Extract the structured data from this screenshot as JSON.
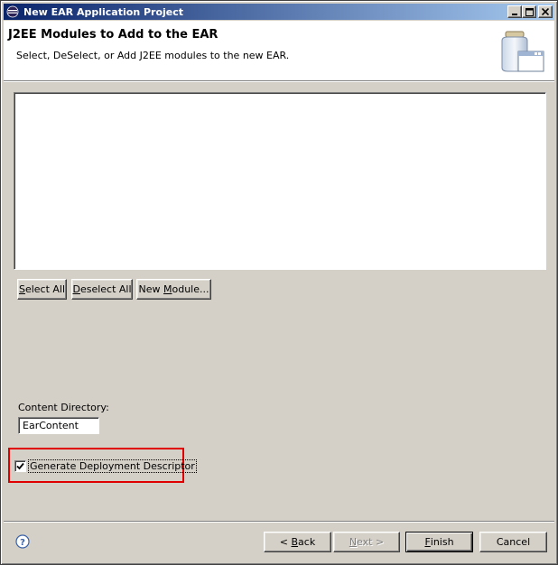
{
  "window": {
    "title": "New EAR Application Project"
  },
  "banner": {
    "title": "J2EE Modules to Add to the EAR",
    "description": "Select, DeSelect, or Add J2EE modules to the new EAR."
  },
  "module_list": {
    "items": []
  },
  "module_buttons": {
    "select_all_mnemonic": "S",
    "select_all_rest": "elect All",
    "deselect_all_mnemonic": "D",
    "deselect_all_rest": "eselect All",
    "new_module_prefix": "New ",
    "new_module_mnemonic": "M",
    "new_module_rest": "odule..."
  },
  "content_directory": {
    "label": "Content Directory:",
    "value": "EarContent"
  },
  "deployment_descriptor": {
    "label": "Generate Deployment Descriptor",
    "checked": true
  },
  "footer": {
    "back_prefix": "< ",
    "back_mnemonic": "B",
    "back_rest": "ack",
    "next_mnemonic": "N",
    "next_rest": "ext >",
    "finish_mnemonic": "F",
    "finish_rest": "inish",
    "cancel_label": "Cancel"
  },
  "colors": {
    "title_bar_start": "#0a246a",
    "title_bar_end": "#a6caf0",
    "face": "#d4d0c8",
    "highlight_border": "#e00000"
  },
  "icons": {
    "app": "eclipse-icon",
    "banner": "jar-window-icon",
    "help": "help-icon"
  }
}
